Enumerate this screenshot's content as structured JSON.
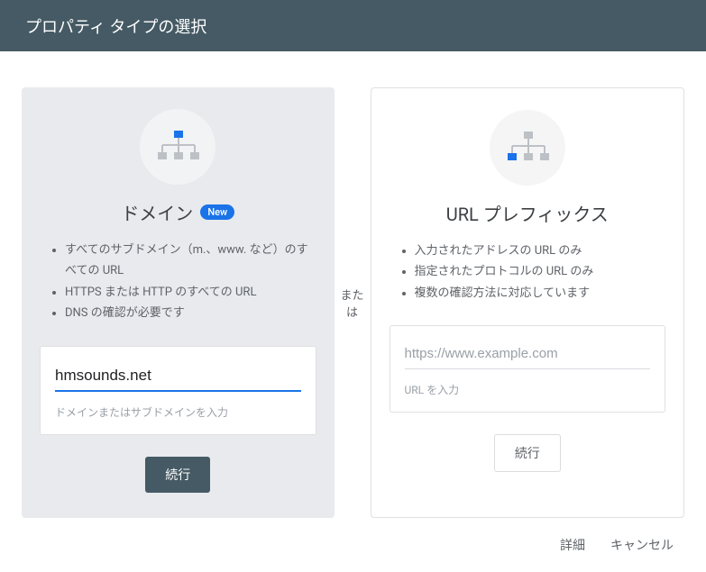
{
  "header": {
    "title": "プロパティ タイプの選択"
  },
  "divider": "または",
  "card_domain": {
    "title": "ドメイン",
    "badge": "New",
    "bullets": [
      "すべてのサブドメイン（m.、www. など）のすべての URL",
      "HTTPS または HTTP のすべての URL",
      "DNS の確認が必要です"
    ],
    "input_value": "hmsounds.net",
    "input_helper": "ドメインまたはサブドメインを入力",
    "button": "続行"
  },
  "card_urlprefix": {
    "title": "URL プレフィックス",
    "bullets": [
      "入力されたアドレスの URL のみ",
      "指定されたプロトコルの URL のみ",
      "複数の確認方法に対応しています"
    ],
    "input_placeholder": "https://www.example.com",
    "input_helper": "URL を入力",
    "button": "続行"
  },
  "footer": {
    "details": "詳細",
    "cancel": "キャンセル"
  }
}
